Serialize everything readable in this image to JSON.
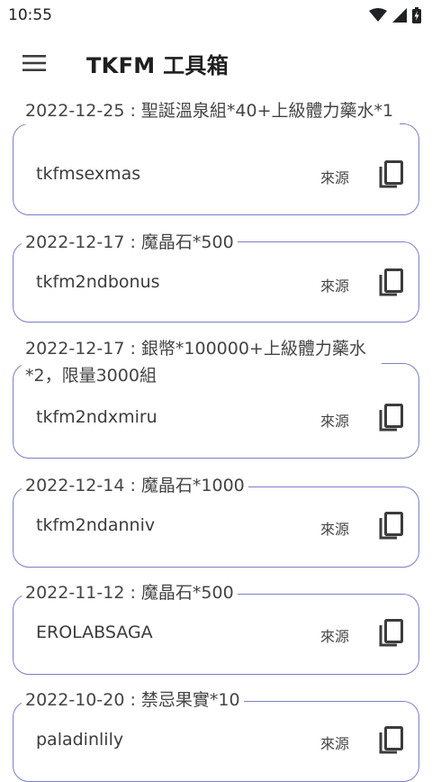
{
  "status": {
    "time": "10:55"
  },
  "app": {
    "title": "TKFM 工具箱"
  },
  "items": [
    {
      "legend": "2022-12-25 : 聖誕溫泉組*40+上級體力藥水*1",
      "code": "tkfmsexmas",
      "source": "來源"
    },
    {
      "legend": "2022-12-17 : 魔晶石*500",
      "code": "tkfm2ndbonus",
      "source": "來源"
    },
    {
      "legend": "2022-12-17 : 銀幣*100000+上級體力藥水*2，限量3000組",
      "code": "tkfm2ndxmiru",
      "source": "來源"
    },
    {
      "legend": "2022-12-14 : 魔晶石*1000",
      "code": "tkfm2ndanniv",
      "source": "來源"
    },
    {
      "legend": "2022-11-12 : 魔晶石*500",
      "code": "EROLABSAGA",
      "source": "來源"
    },
    {
      "legend": "2022-10-20 : 禁忌果實*10",
      "code": "paladinlily",
      "source": "來源"
    }
  ]
}
